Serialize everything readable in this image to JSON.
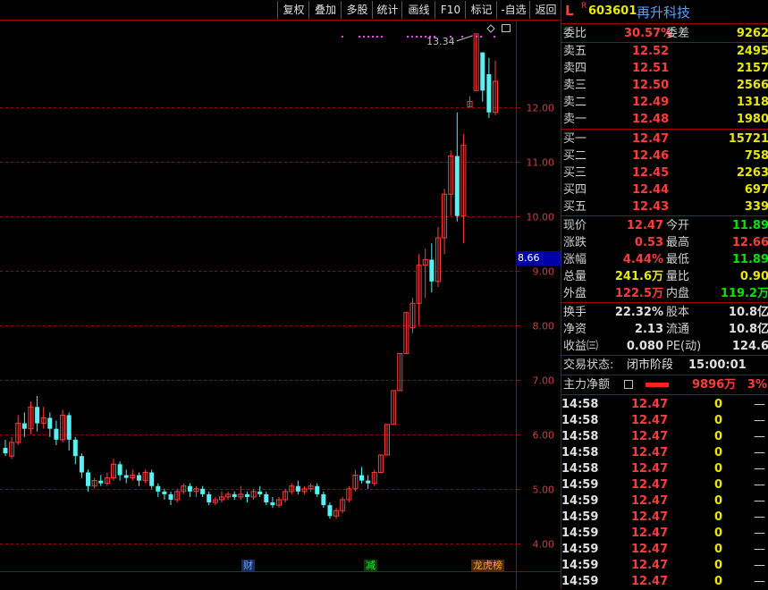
{
  "toolbar": {
    "buttons": [
      "复权",
      "叠加",
      "多股",
      "统计",
      "画线",
      "F10",
      "标记",
      "-自选",
      "返回"
    ]
  },
  "chart": {
    "y_ticks": [
      "12.00",
      "11.00",
      "10.00",
      "9.00",
      "8.00",
      "7.00",
      "6.00",
      "5.00",
      "4.00"
    ],
    "last_price_box": "8.66",
    "high_label": "13.34",
    "event_tags": [
      {
        "text": "财",
        "color": "#5090ff"
      },
      {
        "text": "减",
        "color": "#00e000"
      },
      {
        "text": "龙虎榜",
        "color": "#ffa040"
      }
    ]
  },
  "chart_data": {
    "type": "candlestick",
    "ylim": [
      3.8,
      13.6
    ],
    "y_ticks": [
      4,
      5,
      6,
      7,
      8,
      9,
      10,
      11,
      12
    ],
    "candles": [
      [
        5.75,
        5.65,
        5.9,
        5.6
      ],
      [
        5.6,
        5.85,
        5.95,
        5.55
      ],
      [
        5.85,
        6.2,
        6.35,
        5.8
      ],
      [
        6.2,
        6.1,
        6.4,
        5.95
      ],
      [
        6.1,
        6.5,
        6.6,
        6.0
      ],
      [
        6.5,
        6.2,
        6.7,
        6.05
      ],
      [
        6.2,
        6.3,
        6.5,
        6.1
      ],
      [
        6.3,
        6.1,
        6.4,
        5.95
      ],
      [
        6.1,
        5.9,
        6.25,
        5.8
      ],
      [
        5.9,
        6.35,
        6.45,
        5.85
      ],
      [
        6.35,
        5.9,
        6.4,
        5.7
      ],
      [
        5.9,
        5.6,
        5.95,
        5.45
      ],
      [
        5.6,
        5.3,
        5.65,
        5.2
      ],
      [
        5.3,
        5.05,
        5.35,
        4.95
      ],
      [
        5.05,
        5.15,
        5.2,
        5.0
      ],
      [
        5.15,
        5.1,
        5.25,
        5.05
      ],
      [
        5.1,
        5.2,
        5.3,
        5.05
      ],
      [
        5.2,
        5.45,
        5.55,
        5.15
      ],
      [
        5.45,
        5.25,
        5.5,
        5.15
      ],
      [
        5.25,
        5.2,
        5.35,
        5.1
      ],
      [
        5.2,
        5.25,
        5.35,
        5.15
      ],
      [
        5.25,
        5.15,
        5.3,
        5.05
      ],
      [
        5.15,
        5.3,
        5.35,
        5.1
      ],
      [
        5.3,
        5.05,
        5.35,
        5.0
      ],
      [
        5.05,
        4.95,
        5.1,
        4.85
      ],
      [
        4.95,
        4.9,
        5.0,
        4.8
      ],
      [
        4.9,
        4.8,
        4.95,
        4.7
      ],
      [
        4.8,
        4.95,
        5.0,
        4.75
      ],
      [
        4.95,
        5.05,
        5.1,
        4.9
      ],
      [
        5.05,
        4.95,
        5.1,
        4.85
      ],
      [
        4.95,
        5.0,
        5.05,
        4.85
      ],
      [
        5.0,
        4.9,
        5.05,
        4.85
      ],
      [
        4.9,
        4.75,
        4.95,
        4.7
      ],
      [
        4.75,
        4.8,
        4.85,
        4.7
      ],
      [
        4.8,
        4.85,
        4.95,
        4.75
      ],
      [
        4.85,
        4.9,
        4.95,
        4.8
      ],
      [
        4.9,
        4.85,
        4.95,
        4.8
      ],
      [
        4.85,
        4.9,
        5.05,
        4.8
      ],
      [
        4.9,
        4.85,
        4.95,
        4.75
      ],
      [
        4.85,
        4.95,
        5.0,
        4.8
      ],
      [
        4.95,
        4.9,
        5.05,
        4.85
      ],
      [
        4.9,
        4.75,
        4.95,
        4.7
      ],
      [
        4.75,
        4.7,
        4.85,
        4.65
      ],
      [
        4.7,
        4.8,
        4.85,
        4.65
      ],
      [
        4.8,
        4.95,
        5.0,
        4.75
      ],
      [
        4.95,
        5.05,
        5.1,
        4.9
      ],
      [
        5.05,
        4.95,
        5.15,
        4.9
      ],
      [
        4.95,
        5.0,
        5.05,
        4.9
      ],
      [
        5.0,
        5.05,
        5.1,
        4.95
      ],
      [
        5.05,
        4.9,
        5.1,
        4.85
      ],
      [
        4.9,
        4.7,
        4.95,
        4.65
      ],
      [
        4.7,
        4.5,
        4.75,
        4.45
      ],
      [
        4.5,
        4.6,
        4.65,
        4.45
      ],
      [
        4.6,
        4.8,
        4.85,
        4.55
      ],
      [
        4.8,
        5.0,
        5.05,
        4.75
      ],
      [
        5.0,
        5.25,
        5.35,
        4.95
      ],
      [
        5.25,
        5.15,
        5.4,
        5.1
      ],
      [
        5.15,
        5.1,
        5.25,
        5.0
      ],
      [
        5.1,
        5.3,
        5.35,
        5.05
      ],
      [
        5.3,
        5.62,
        5.62,
        5.3
      ],
      [
        5.62,
        6.18,
        6.18,
        5.62
      ],
      [
        6.18,
        6.8,
        6.8,
        6.18
      ],
      [
        6.8,
        7.48,
        7.48,
        6.8
      ],
      [
        7.48,
        8.23,
        8.23,
        7.48
      ],
      [
        7.95,
        8.4,
        8.5,
        7.85
      ],
      [
        8.4,
        9.1,
        9.3,
        8.0
      ],
      [
        9.1,
        9.2,
        9.4,
        8.5
      ],
      [
        9.2,
        8.8,
        9.5,
        8.6
      ],
      [
        8.8,
        9.6,
        9.8,
        8.7
      ],
      [
        9.6,
        10.4,
        10.5,
        9.3
      ],
      [
        10.4,
        11.1,
        11.2,
        10.0
      ],
      [
        11.1,
        10.0,
        11.9,
        9.9
      ],
      [
        10.0,
        11.3,
        11.5,
        9.5
      ],
      [
        12.0,
        12.1,
        12.2,
        12.0
      ],
      [
        12.3,
        13.34,
        13.34,
        12.3
      ],
      [
        13.0,
        12.3,
        13.0,
        12.1
      ],
      [
        12.6,
        11.9,
        12.9,
        11.8
      ],
      [
        11.9,
        12.47,
        12.85,
        11.85
      ]
    ]
  },
  "panel": {
    "header": {
      "mark_l": "L",
      "mark_r": "R",
      "code": "603601",
      "name": "再升科技"
    },
    "weibi": {
      "label": "委比",
      "value": "30.57%",
      "label2": "委差",
      "value2": "9262"
    },
    "sell": [
      {
        "label": "卖五",
        "price": "12.52",
        "vol": "2495"
      },
      {
        "label": "卖四",
        "price": "12.51",
        "vol": "2157"
      },
      {
        "label": "卖三",
        "price": "12.50",
        "vol": "2566"
      },
      {
        "label": "卖二",
        "price": "12.49",
        "vol": "1318"
      },
      {
        "label": "卖一",
        "price": "12.48",
        "vol": "1980"
      }
    ],
    "buy": [
      {
        "label": "买一",
        "price": "12.47",
        "vol": "15721"
      },
      {
        "label": "买二",
        "price": "12.46",
        "vol": "758"
      },
      {
        "label": "买三",
        "price": "12.45",
        "vol": "2263"
      },
      {
        "label": "买四",
        "price": "12.44",
        "vol": "697"
      },
      {
        "label": "买五",
        "price": "12.43",
        "vol": "339"
      }
    ],
    "stats": [
      {
        "l1": "现价",
        "v1": "12.47",
        "c1": "red",
        "l2": "今开",
        "v2": "11.89",
        "c2": "green"
      },
      {
        "l1": "涨跌",
        "v1": "0.53",
        "c1": "red",
        "l2": "最高",
        "v2": "12.66",
        "c2": "red"
      },
      {
        "l1": "涨幅",
        "v1": "4.44%",
        "c1": "red",
        "l2": "最低",
        "v2": "11.89",
        "c2": "green"
      },
      {
        "l1": "总量",
        "v1": "241.6万",
        "c1": "yellow",
        "l2": "量比",
        "v2": "0.90",
        "c2": "yellow"
      },
      {
        "l1": "外盘",
        "v1": "122.5万",
        "c1": "red",
        "l2": "内盘",
        "v2": "119.2万",
        "c2": "green"
      }
    ],
    "fundamentals": [
      {
        "l1": "换手",
        "v1": "22.32%",
        "l2": "股本",
        "v2": "10.8亿"
      },
      {
        "l1": "净资",
        "v1": "2.13",
        "l2": "流通",
        "v2": "10.8亿"
      },
      {
        "l1": "收益㈢",
        "v1": "0.080",
        "l2": "PE(动)",
        "v2": "124.6"
      }
    ],
    "trade_status": {
      "label": "交易状态:",
      "value": "闭市阶段",
      "time": "15:00:01"
    },
    "main_flow": {
      "label": "主力净额",
      "value": "9896万",
      "pct": "3%"
    },
    "ticks": [
      {
        "time": "14:58",
        "price": "12.47",
        "vol": "0",
        "dir": "—"
      },
      {
        "time": "14:58",
        "price": "12.47",
        "vol": "0",
        "dir": "—"
      },
      {
        "time": "14:58",
        "price": "12.47",
        "vol": "0",
        "dir": "—"
      },
      {
        "time": "14:58",
        "price": "12.47",
        "vol": "0",
        "dir": "—"
      },
      {
        "time": "14:58",
        "price": "12.47",
        "vol": "0",
        "dir": "—"
      },
      {
        "time": "14:59",
        "price": "12.47",
        "vol": "0",
        "dir": "—"
      },
      {
        "time": "14:59",
        "price": "12.47",
        "vol": "0",
        "dir": "—"
      },
      {
        "time": "14:59",
        "price": "12.47",
        "vol": "0",
        "dir": "—"
      },
      {
        "time": "14:59",
        "price": "12.47",
        "vol": "0",
        "dir": "—"
      },
      {
        "time": "14:59",
        "price": "12.47",
        "vol": "0",
        "dir": "—"
      },
      {
        "time": "14:59",
        "price": "12.47",
        "vol": "0",
        "dir": "—"
      },
      {
        "time": "14:59",
        "price": "12.47",
        "vol": "0",
        "dir": "—"
      }
    ],
    "colors": {
      "up": "#ff3c3c",
      "down": "#58f0f0",
      "grid": "#a00000",
      "bg": "#000000"
    }
  }
}
